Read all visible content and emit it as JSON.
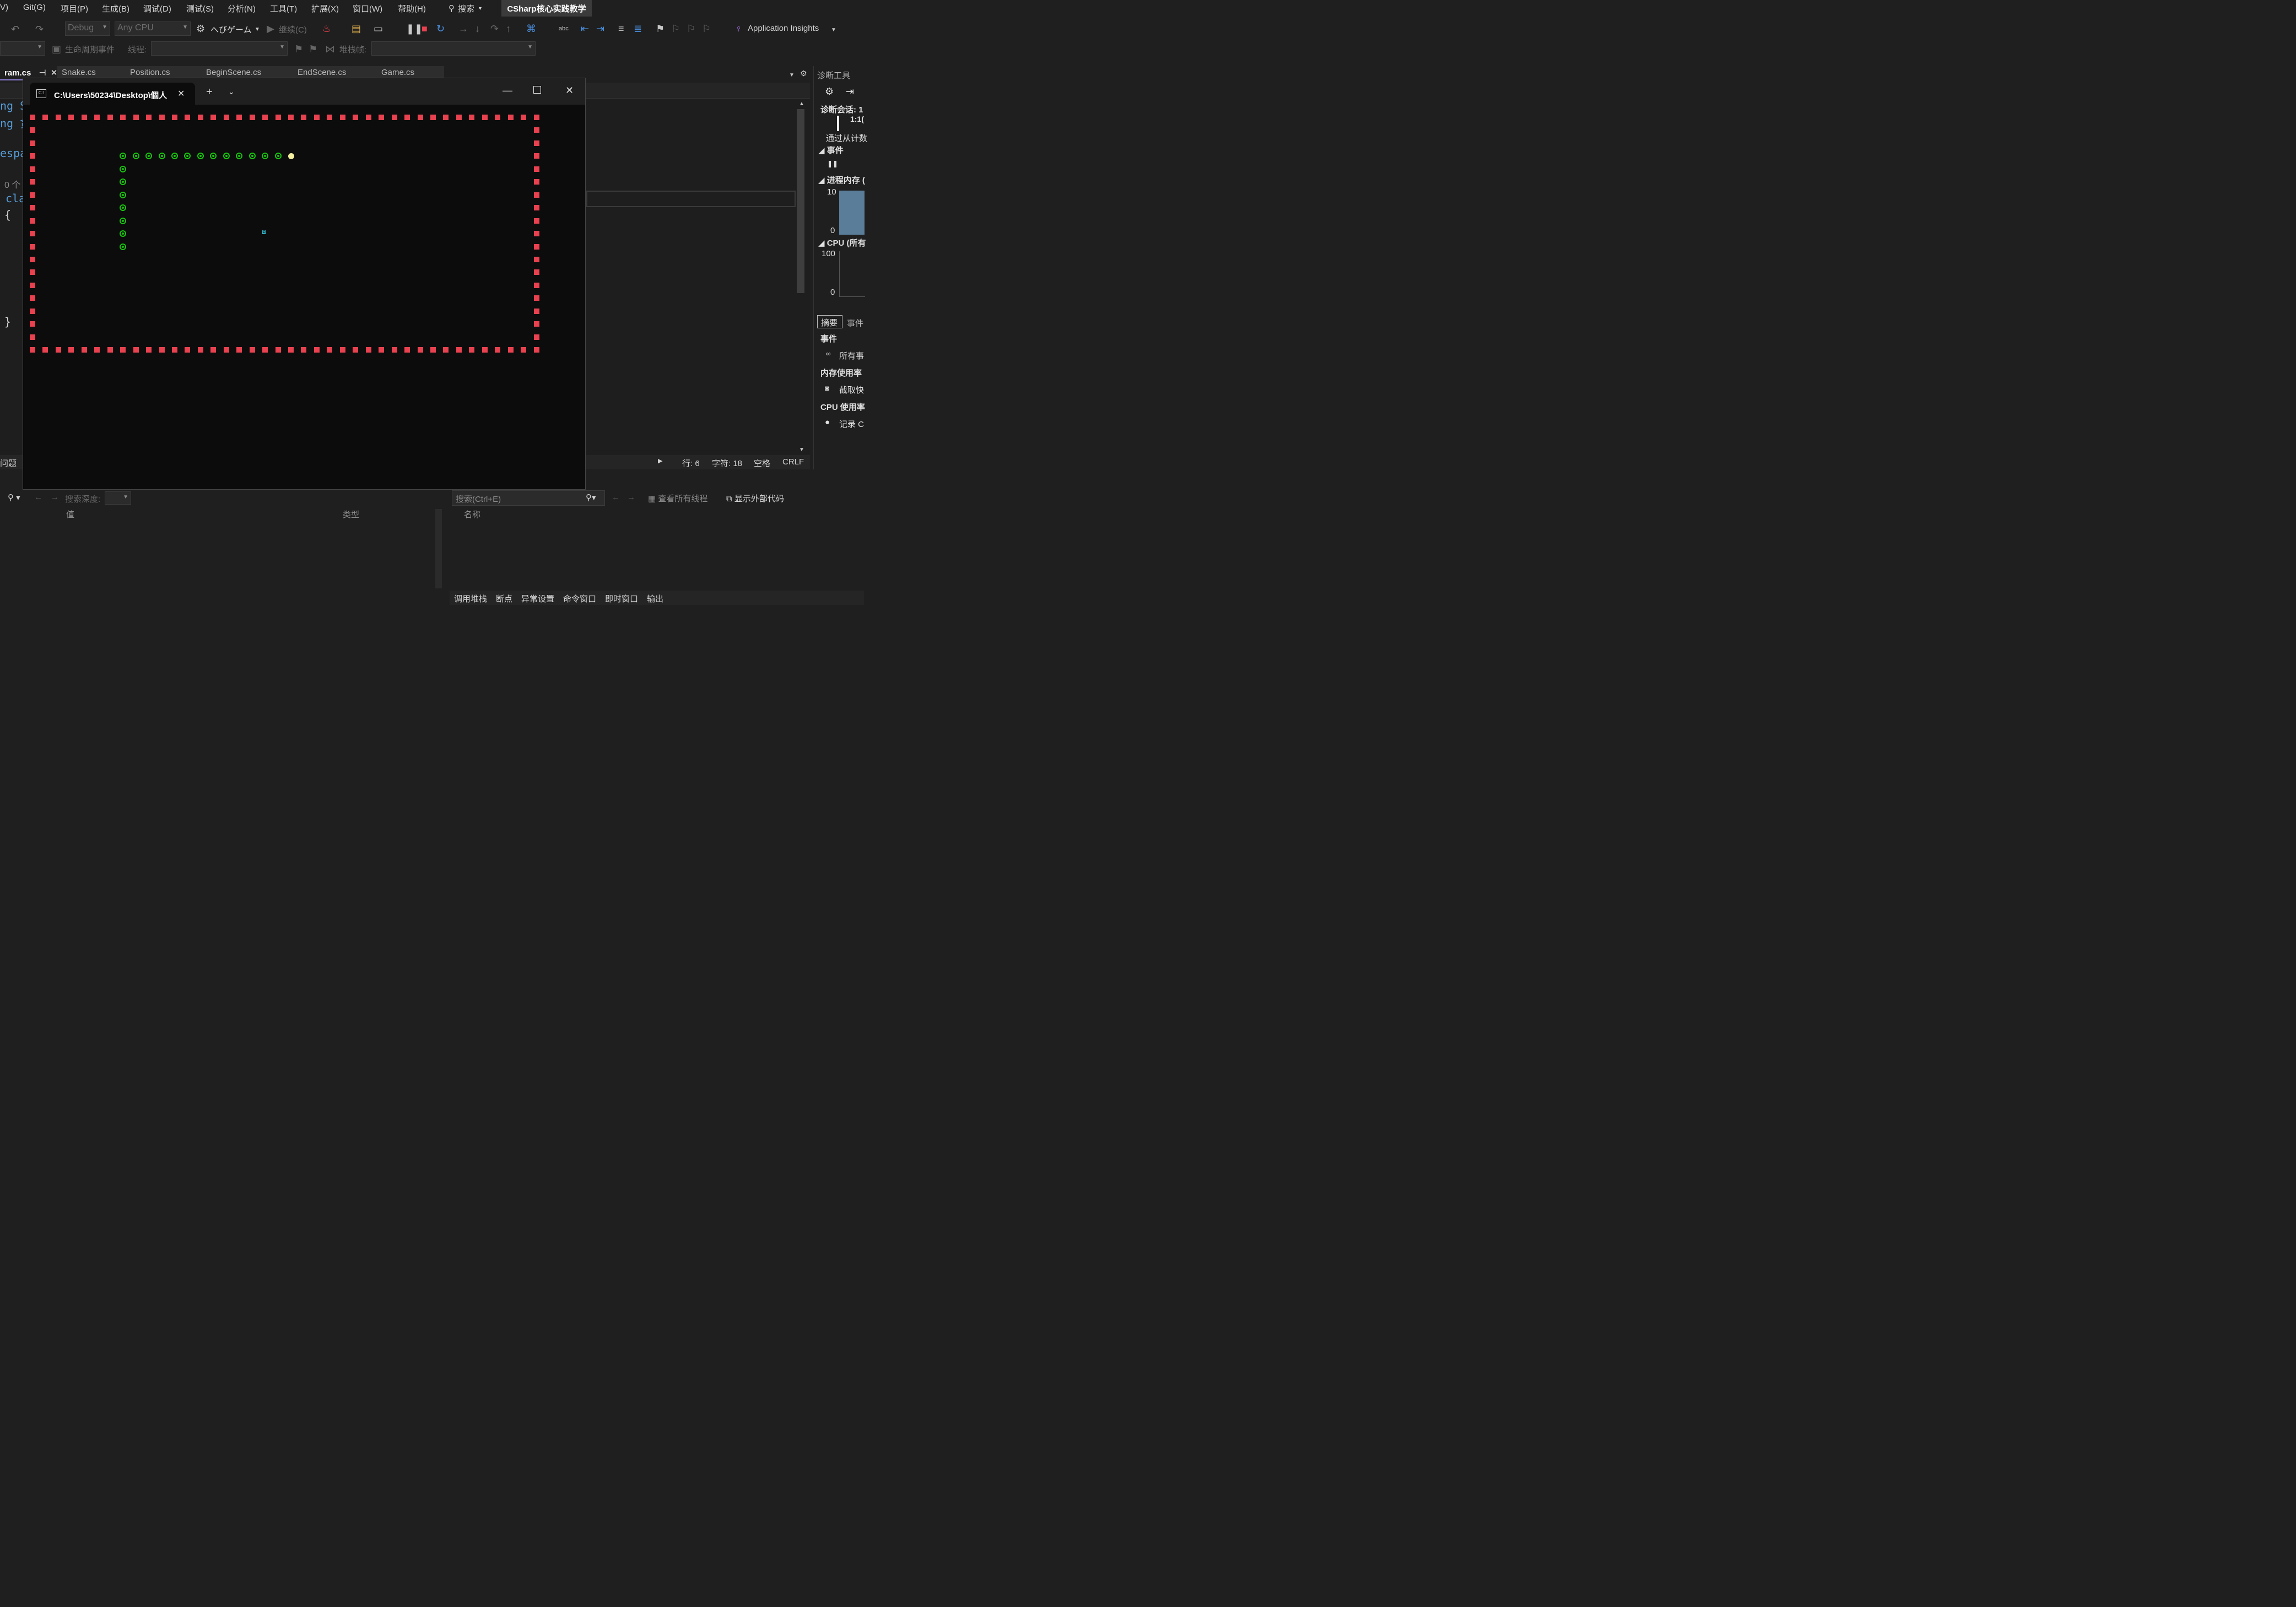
{
  "menubar": {
    "items": [
      "V)",
      "Git(G)",
      "项目(P)",
      "生成(B)",
      "调试(D)",
      "测试(S)",
      "分析(N)",
      "工具(T)",
      "扩展(X)",
      "窗口(W)",
      "帮助(H)"
    ],
    "search_label": "搜索",
    "project_title": "CSharp核心实践教学"
  },
  "toolbar": {
    "config": "Debug",
    "platform": "Any CPU",
    "startup_project": "へびゲーム",
    "continue_label": "继续(C)",
    "app_insights": "Application Insights"
  },
  "toolbar2": {
    "lifecycle_label": "生命周期事件",
    "thread_label": "线程:",
    "stackframe_label": "堆栈帧:"
  },
  "doc_tabs": [
    "ram.cs",
    "Snake.cs",
    "Position.cs",
    "BeginScene.cs",
    "EndScene.cs",
    "Game.cs"
  ],
  "code_fragments": [
    "ng S",
    "ng 贪",
    "espa",
    "0 个",
    "cla",
    "{",
    "}"
  ],
  "status": {
    "problems": "问题",
    "line": "行: 6",
    "char": "字符: 18",
    "space": "空格",
    "eol": "CRLF"
  },
  "diag": {
    "title": "诊断工具",
    "session": "诊断会话: 1",
    "time": "1:1(",
    "calc": "通过从计数",
    "events": "事件",
    "memory": "进程内存 (",
    "mem_max": "10",
    "mem_min": "0",
    "cpu": "CPU (所有",
    "cpu_max": "100",
    "cpu_min": "0",
    "tab_summary": "摘要",
    "tab_events": "事件",
    "sec_events": "事件",
    "all_events": "所有事",
    "sec_memory": "内存使用率",
    "snapshot": "截取快",
    "sec_cpu": "CPU 使用率",
    "record": "记录 C"
  },
  "locals": {
    "search_depth": "搜索深度:",
    "col_value": "值",
    "col_type": "类型"
  },
  "callstack": {
    "search_placeholder": "搜索(Ctrl+E)",
    "view_threads": "查看所有线程",
    "show_external": "显示外部代码",
    "col_name": "名称",
    "bottom_tabs": [
      "调用堆栈",
      "断点",
      "异常设置",
      "命令窗口",
      "即时窗口",
      "输出"
    ]
  },
  "console": {
    "title": "C:\\Users\\50234\\Desktop\\個人",
    "colors": {
      "wall": "#e8414f",
      "snake": "#16c60c",
      "head": "#f5f0a0",
      "food": "#3ad0e8"
    },
    "food_glyph": "¤"
  }
}
